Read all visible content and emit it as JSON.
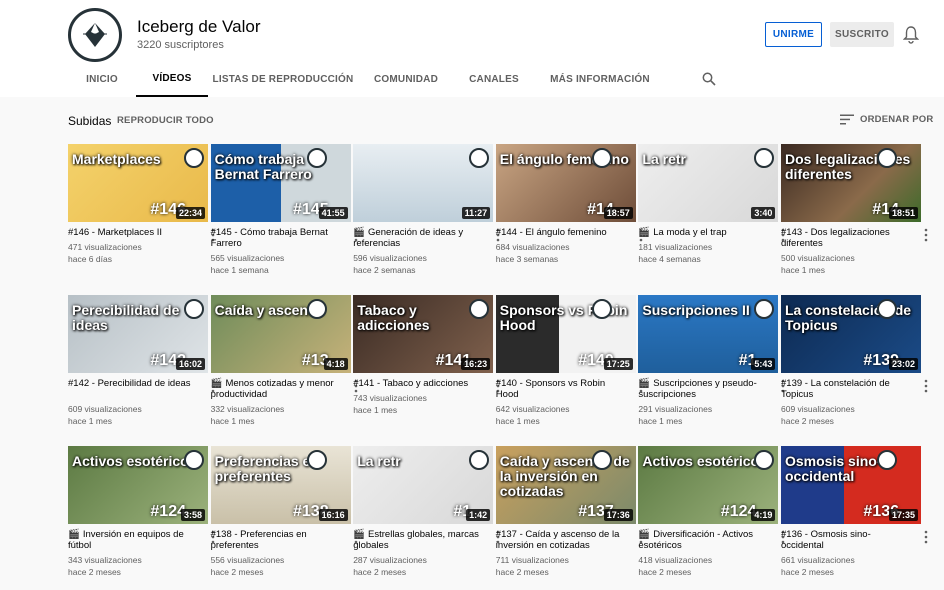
{
  "channel": {
    "name": "Iceberg de Valor",
    "subscribers": "3220 suscriptores"
  },
  "buttons": {
    "join": "UNIRME",
    "subscribed": "SUSCRITO"
  },
  "tabs": [
    {
      "label": "INICIO"
    },
    {
      "label": "VÍDEOS"
    },
    {
      "label": "LISTAS DE REPRODUCCIÓN"
    },
    {
      "label": "COMUNIDAD"
    },
    {
      "label": "CANALES"
    },
    {
      "label": "MÁS INFORMACIÓN"
    }
  ],
  "section": {
    "title": "Subidas",
    "play_all": "REPRODUCIR TODO",
    "sort": "ORDENAR POR"
  },
  "colors": {
    "accent": "#065fd4",
    "text": "#030303",
    "meta": "#606060"
  },
  "videos": [
    {
      "title": "#146 - Marketplaces II",
      "views": "471 visualizaciones",
      "age": "hace 6 días",
      "duration": "22:34",
      "thumb_text": "Marketplaces",
      "thumb_num": "#146",
      "clapper": false
    },
    {
      "title": "#145 - Cómo trabaja Bernat Farrero",
      "views": "565 visualizaciones",
      "age": "hace 1 semana",
      "duration": "41:55",
      "thumb_text": "Cómo trabaja Bernat Farrero",
      "thumb_num": "#145",
      "clapper": false
    },
    {
      "title": "Generación de ideas y referencias",
      "views": "596 visualizaciones",
      "age": "hace 2 semanas",
      "duration": "11:27",
      "thumb_text": "",
      "thumb_num": "",
      "clapper": true
    },
    {
      "title": "#144 - El ángulo femenino",
      "views": "684 visualizaciones",
      "age": "hace 3 semanas",
      "duration": "18:57",
      "thumb_text": "El ángulo femenino",
      "thumb_num": "#14",
      "clapper": false
    },
    {
      "title": "La moda y el trap",
      "views": "181 visualizaciones",
      "age": "hace 4 semanas",
      "duration": "3:40",
      "thumb_text": "La retr",
      "thumb_num": "",
      "clapper": true
    },
    {
      "title": "#143 - Dos legalizaciones diferentes",
      "views": "500 visualizaciones",
      "age": "hace 1 mes",
      "duration": "18:51",
      "thumb_text": "Dos legalizaciones diferentes",
      "thumb_num": "#14",
      "clapper": false
    },
    {
      "title": "#142 - Perecibilidad de ideas",
      "views": "609 visualizaciones",
      "age": "hace 1 mes",
      "duration": "16:02",
      "thumb_text": "Perecibilidad de ideas",
      "thumb_num": "#142",
      "clapper": false
    },
    {
      "title": "Menos cotizadas y menor productividad",
      "views": "332 visualizaciones",
      "age": "hace 1 mes",
      "duration": "4:18",
      "thumb_text": "Caída y ascenso",
      "thumb_num": "#13",
      "clapper": true
    },
    {
      "title": "#141 - Tabaco y adicciones",
      "views": "743 visualizaciones",
      "age": "hace 1 mes",
      "duration": "16:23",
      "thumb_text": "Tabaco y adicciones",
      "thumb_num": "#141",
      "clapper": false
    },
    {
      "title": "#140 - Sponsors vs Robin Hood",
      "views": "642 visualizaciones",
      "age": "hace 1 mes",
      "duration": "17:25",
      "thumb_text": "Sponsors vs Robin Hood",
      "thumb_num": "#140",
      "clapper": false
    },
    {
      "title": "Suscripciones y pseudo-suscripciones",
      "views": "291 visualizaciones",
      "age": "hace 1 mes",
      "duration": "5:43",
      "thumb_text": "Suscripciones II",
      "thumb_num": "#1",
      "clapper": true
    },
    {
      "title": "#139 - La constelación de Topicus",
      "views": "609 visualizaciones",
      "age": "hace 2 meses",
      "duration": "23:02",
      "thumb_text": "La constelación de Topicus",
      "thumb_num": "#139",
      "clapper": false
    },
    {
      "title": "Inversión en equipos de fútbol",
      "views": "343 visualizaciones",
      "age": "hace 2 meses",
      "duration": "3:58",
      "thumb_text": "Activos esotéricos",
      "thumb_num": "#124",
      "clapper": true
    },
    {
      "title": "#138 - Preferencias en preferentes",
      "views": "556 visualizaciones",
      "age": "hace 2 meses",
      "duration": "16:16",
      "thumb_text": "Preferencias en preferentes",
      "thumb_num": "#138",
      "clapper": false
    },
    {
      "title": "Estrellas globales, marcas globales",
      "views": "287 visualizaciones",
      "age": "hace 2 meses",
      "duration": "1:42",
      "thumb_text": "La retr",
      "thumb_num": "#1",
      "clapper": true
    },
    {
      "title": "#137 - Caída y ascenso de la inversión en cotizadas",
      "views": "711 visualizaciones",
      "age": "hace 2 meses",
      "duration": "17:36",
      "thumb_text": "Caída y ascenso de la inversión en cotizadas",
      "thumb_num": "#137",
      "clapper": false
    },
    {
      "title": "Diversificación - Activos esotéricos",
      "views": "418 visualizaciones",
      "age": "hace 2 meses",
      "duration": "4:19",
      "thumb_text": "Activos esotéricos",
      "thumb_num": "#124",
      "clapper": true
    },
    {
      "title": "#136 - Osmosis sino-occidental",
      "views": "661 visualizaciones",
      "age": "hace 2 meses",
      "duration": "17:35",
      "thumb_text": "Osmosis sino-occidental",
      "thumb_num": "#136",
      "clapper": false
    }
  ]
}
